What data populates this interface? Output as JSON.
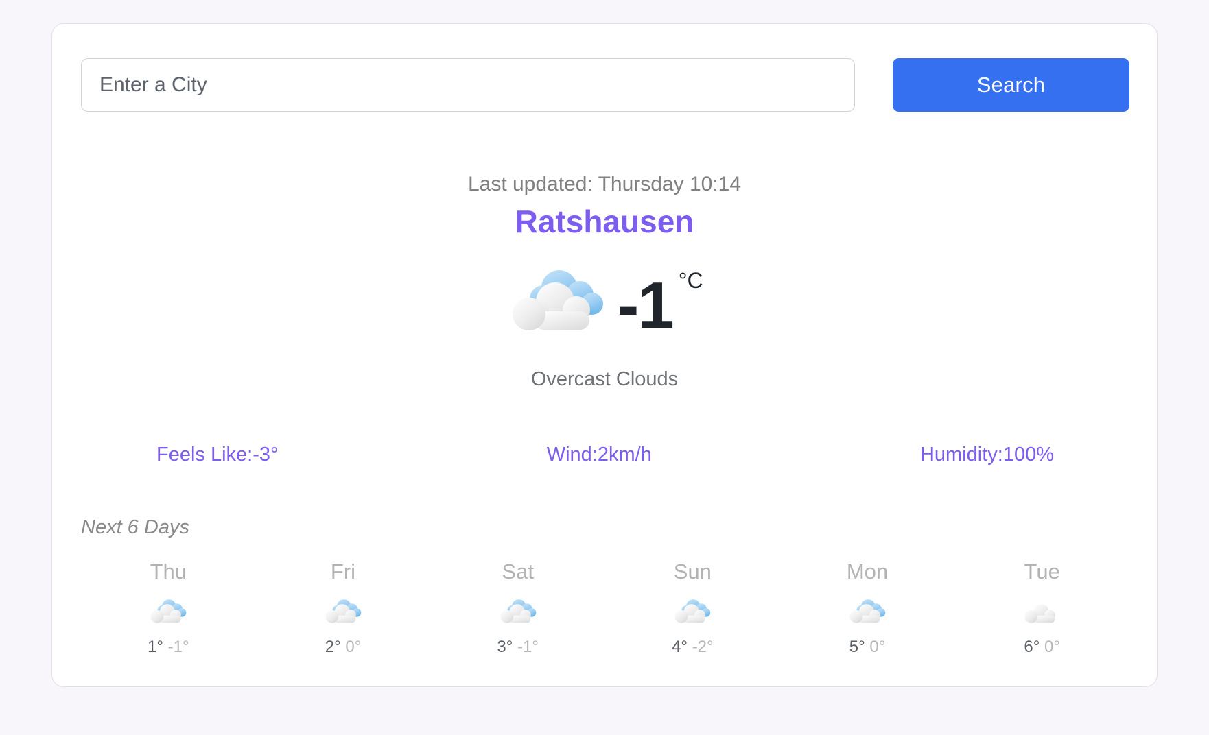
{
  "search": {
    "placeholder": "Enter a City",
    "value": "",
    "button_label": "Search"
  },
  "current": {
    "last_updated": "Last updated: Thursday 10:14",
    "city": "Ratshausen",
    "temperature": "-1",
    "unit": "°C",
    "condition": "Overcast Clouds",
    "icon": "overcast-clouds-icon"
  },
  "stats": [
    {
      "name": "feels-like",
      "text": "Feels Like:-3°"
    },
    {
      "name": "wind",
      "text": "Wind:2km/h"
    },
    {
      "name": "humidity",
      "text": "Humidity:100%"
    }
  ],
  "forecast": {
    "heading": "Next 6 Days",
    "days": [
      {
        "day": "Thu",
        "max": "1°",
        "min": "-1°",
        "icon": "overcast-clouds-icon"
      },
      {
        "day": "Fri",
        "max": "2°",
        "min": "0°",
        "icon": "overcast-clouds-icon"
      },
      {
        "day": "Sat",
        "max": "3°",
        "min": "-1°",
        "icon": "overcast-clouds-icon"
      },
      {
        "day": "Sun",
        "max": "4°",
        "min": "-2°",
        "icon": "overcast-clouds-icon"
      },
      {
        "day": "Mon",
        "max": "5°",
        "min": "0°",
        "icon": "overcast-clouds-icon"
      },
      {
        "day": "Tue",
        "max": "6°",
        "min": "0°",
        "icon": "broken-clouds-gray-icon"
      }
    ]
  },
  "colors": {
    "page_background": "#f8f6fb",
    "card_background": "#ffffff",
    "accent_purple": "#7d5cf0",
    "button_blue": "#3470ef",
    "muted_gray": "#808080",
    "cloud_blue": "#8dc6ef",
    "cloud_gray": "#e2e2e2"
  }
}
